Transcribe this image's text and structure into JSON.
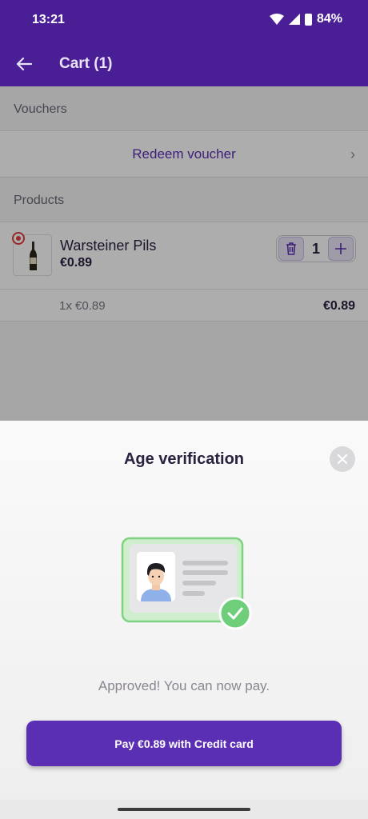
{
  "status_bar": {
    "time": "13:21",
    "battery": "84%",
    "icons": [
      "wifi-icon",
      "signal-icon",
      "battery-icon"
    ]
  },
  "app_bar": {
    "title": "Cart (1)",
    "back_icon": "arrow-left-icon"
  },
  "vouchers": {
    "header": "Vouchers",
    "redeem_label": "Redeem voucher",
    "chevron": "›"
  },
  "products": {
    "header": "Products",
    "items": [
      {
        "name": "Warsteiner Pils",
        "price": "€0.89",
        "quantity": "1",
        "line_detail": "1x €0.89",
        "line_total": "€0.89",
        "age_restricted": true
      }
    ]
  },
  "sheet": {
    "title": "Age verification",
    "approved_text": "Approved! You can now pay.",
    "pay_label": "Pay €0.89 with Credit card",
    "close_icon": "close-icon",
    "illustration": "id-card-verified-icon"
  },
  "colors": {
    "primary": "#5a2fb3",
    "app_bar": "#4a1f96",
    "success": "#6fce7a",
    "age_badge": "#e23a3a"
  }
}
